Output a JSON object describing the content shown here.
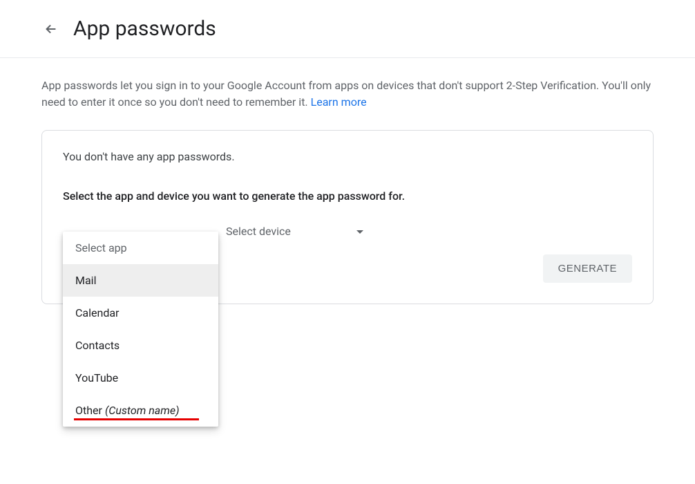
{
  "header": {
    "title": "App passwords"
  },
  "description": {
    "text": "App passwords let you sign in to your Google Account from apps on devices that don't support 2-Step Verification. You'll only need to enter it once so you don't need to remember it. ",
    "learn_more": "Learn more"
  },
  "card": {
    "no_passwords": "You don't have any app passwords.",
    "select_prompt": "Select the app and device you want to generate the app password for.",
    "select_device_label": "Select device",
    "generate_label": "GENERATE"
  },
  "dropdown": {
    "placeholder": "Select app",
    "options": {
      "mail": "Mail",
      "calendar": "Calendar",
      "contacts": "Contacts",
      "youtube": "YouTube",
      "other_main": "Other ",
      "other_suffix": "(Custom name)"
    }
  }
}
